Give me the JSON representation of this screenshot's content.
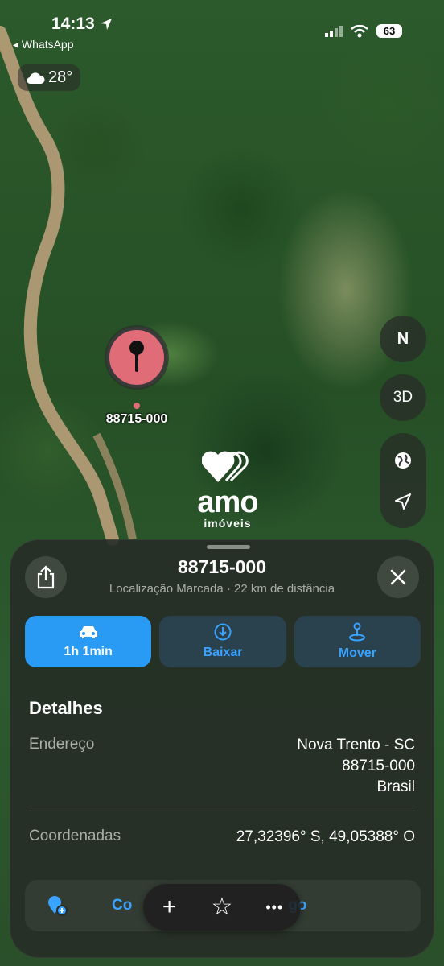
{
  "status": {
    "time": "14:13",
    "back_app": "◂ WhatsApp",
    "battery": "63"
  },
  "weather": {
    "temp": "28°"
  },
  "pin": {
    "label": "88715-000",
    "color": "#e06c78"
  },
  "map_controls": {
    "compass": "N",
    "three_d": "3D"
  },
  "logo": {
    "word": "amo",
    "sub": "imóveis"
  },
  "sheet": {
    "title": "88715-000",
    "subtitle": "Localização Marcada · 22 km de distância",
    "actions": [
      {
        "label": "1h 1min",
        "icon": "car-icon"
      },
      {
        "label": "Baixar",
        "icon": "download-icon"
      },
      {
        "label": "Mover",
        "icon": "move-pin-icon"
      }
    ],
    "details_heading": "Detalhes",
    "address": {
      "label": "Endereço",
      "line1": "Nova Trento - SC",
      "line2": "88715-000",
      "line3": "Brasil"
    },
    "coordinates": {
      "label": "Coordenadas",
      "value": "27,32396° S, 49,05388° O"
    },
    "bottom_row": {
      "text_left": "Co",
      "text_right": "go"
    }
  },
  "toolbar": {
    "add": "+",
    "favorite": "☆",
    "more": "•••"
  },
  "colors": {
    "accent": "#2a9bf5",
    "link": "#3aa3ff"
  }
}
